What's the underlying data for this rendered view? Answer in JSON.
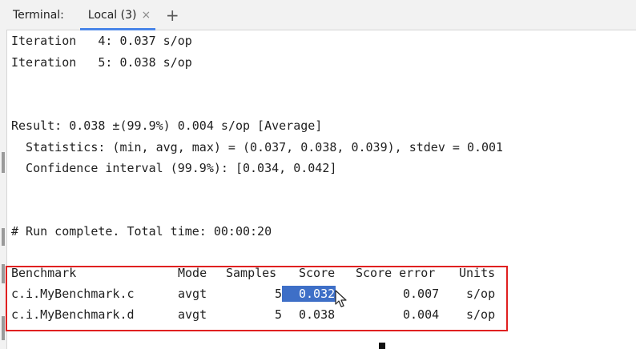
{
  "tabbar": {
    "title": "Terminal:",
    "tab_label": "Local (3)",
    "close_glyph": "×",
    "add_glyph": "+"
  },
  "output": {
    "iter4": "Iteration   4: 0.037 s/op",
    "iter5": "Iteration   5: 0.038 s/op",
    "result": "Result: 0.038 ±(99.9%) 0.004 s/op [Average]",
    "statistics": "  Statistics: (min, avg, max) = (0.037, 0.038, 0.039), stdev = 0.001",
    "confidence": "  Confidence interval (99.9%): [0.034, 0.042]",
    "run_complete": "# Run complete. Total time: 00:00:20"
  },
  "table": {
    "headers": {
      "benchmark": "Benchmark",
      "mode": "Mode",
      "samples": "Samples",
      "score": "Score",
      "score_error": "Score error",
      "units": "Units"
    },
    "rows": [
      {
        "benchmark": "c.i.MyBenchmark.c",
        "mode": "avgt",
        "samples": "5",
        "score": "0.032",
        "score_error": "0.007",
        "units": "s/op"
      },
      {
        "benchmark": "c.i.MyBenchmark.d",
        "mode": "avgt",
        "samples": "5",
        "score": "0.038",
        "score_error": "0.004",
        "units": "s/op"
      }
    ],
    "highlighted_cell": "rows.0.score"
  },
  "colors": {
    "selection": "#3e6fc7",
    "box_border": "#e02020",
    "tab_underline": "#4a86e8"
  },
  "icons": {
    "cursor": "mouse-pointer-icon",
    "close": "close-icon",
    "add": "plus-icon"
  }
}
